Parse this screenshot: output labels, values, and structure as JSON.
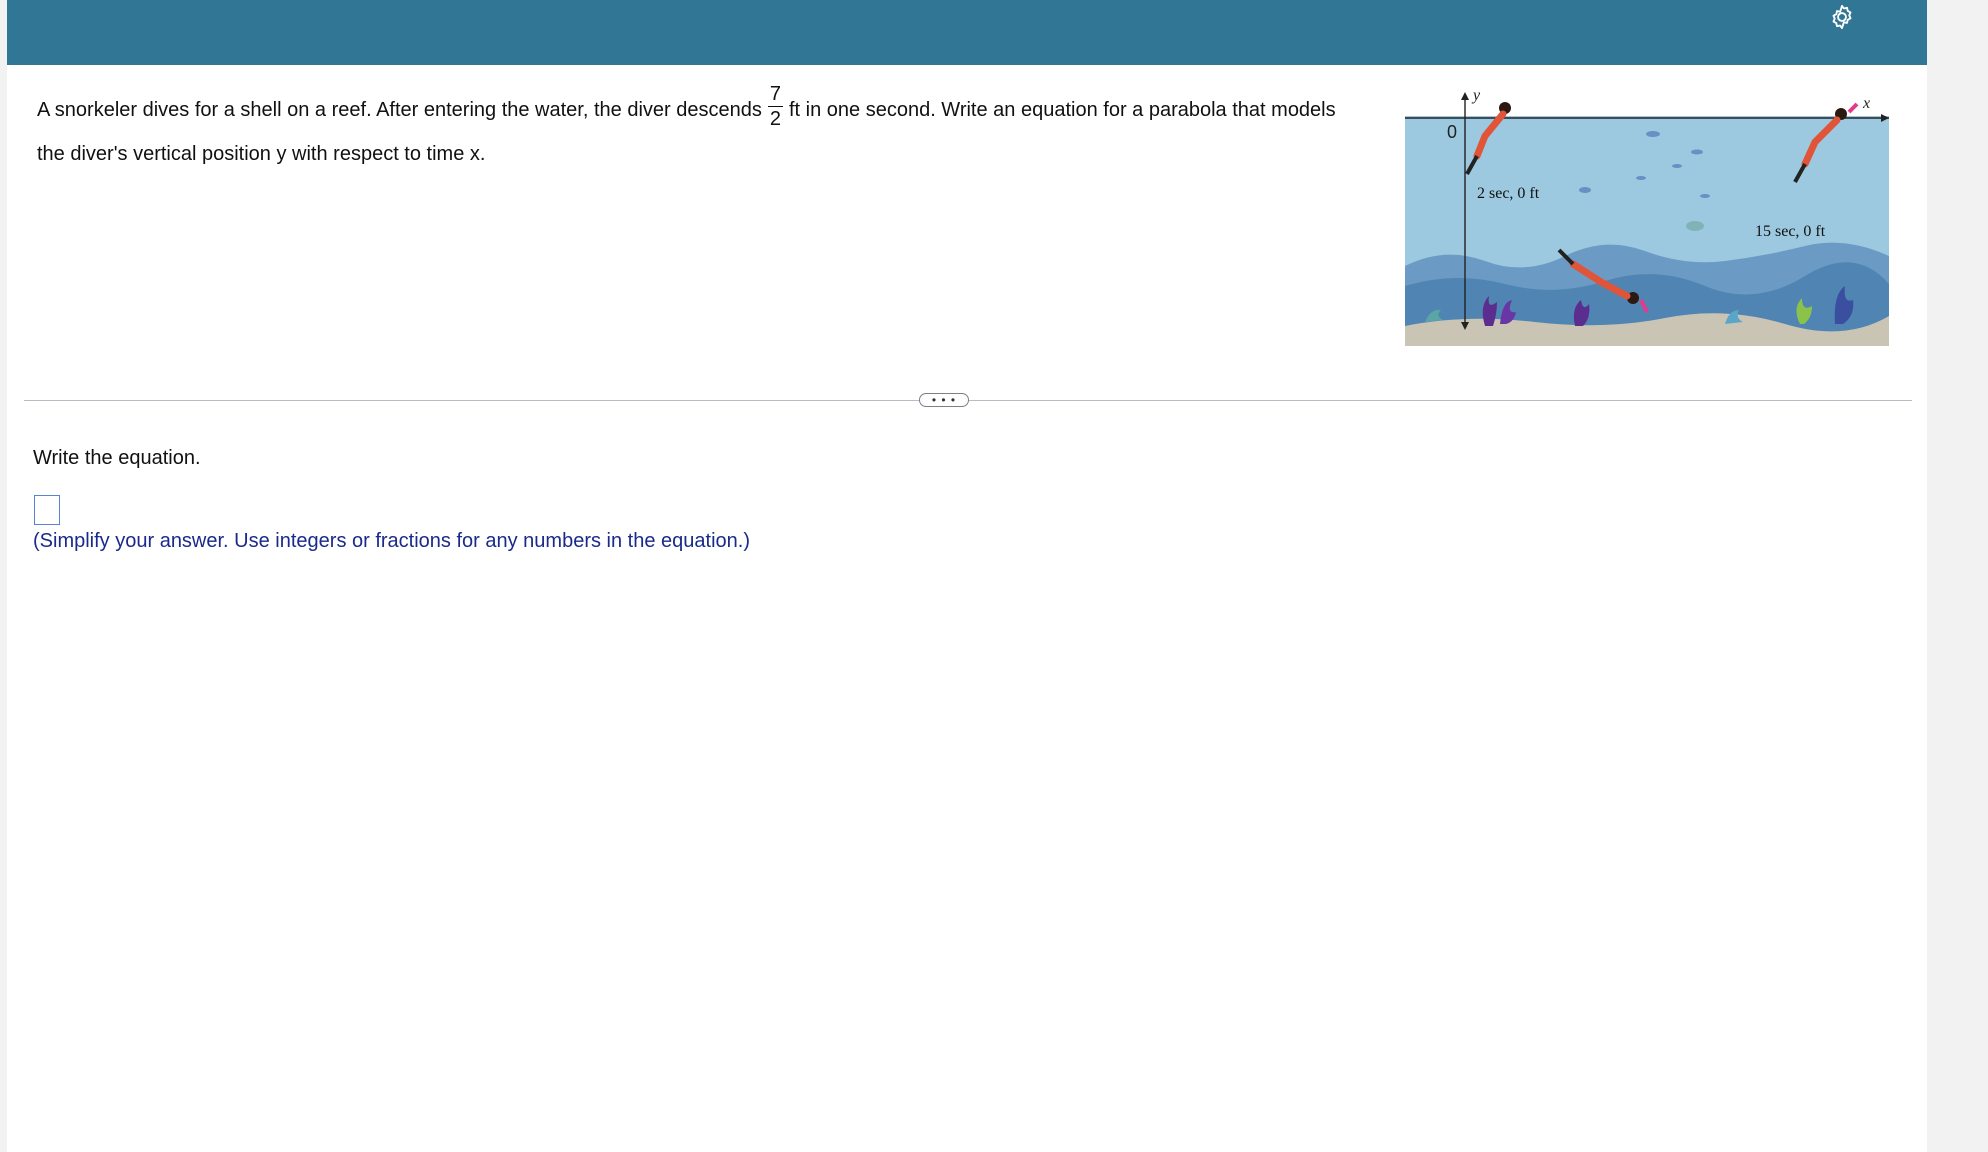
{
  "question": {
    "text_before": "A snorkeler dives for a shell on a reef. After entering the water, the diver descends",
    "fraction": {
      "numerator": "7",
      "denominator": "2"
    },
    "text_after": "ft in one second. Write an equation for a parabola that models the diver's vertical position y with respect to time x."
  },
  "figure": {
    "y_axis_label": "y",
    "x_axis_label": "x",
    "origin_label": "0",
    "point_left_label": "2 sec, 0 ft",
    "point_right_label": "15 sec, 0 ft"
  },
  "divider": {
    "more_label": "• • •"
  },
  "answer": {
    "prompt": "Write the equation.",
    "value": "",
    "hint": "(Simplify your answer. Use integers or fractions for any numbers in the equation.)"
  },
  "colors": {
    "topbar": "#317795",
    "water": "#9cc9df",
    "hint_text": "#1a2a8c",
    "answer_border": "#5b82d1"
  },
  "icons": {
    "settings": "gear-icon"
  }
}
